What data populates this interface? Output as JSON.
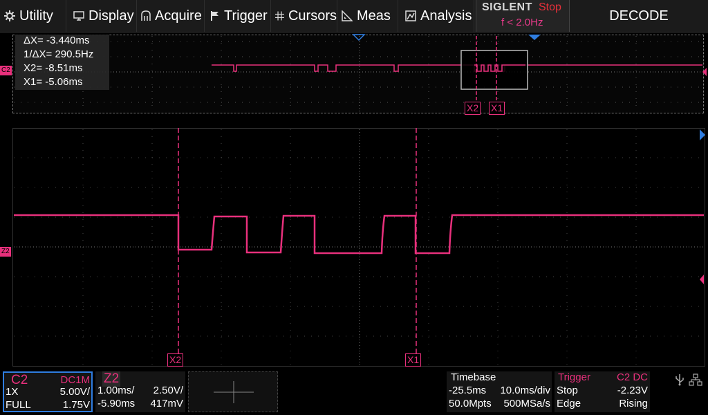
{
  "menu": {
    "items": [
      {
        "label": "Utility",
        "icon": "gear-icon"
      },
      {
        "label": "Display",
        "icon": "monitor-icon"
      },
      {
        "label": "Acquire",
        "icon": "acquire-icon"
      },
      {
        "label": "Trigger",
        "icon": "flag-icon"
      },
      {
        "label": "Cursors",
        "icon": "cursor-grid-icon"
      },
      {
        "label": "Meas",
        "icon": "measure-icon"
      },
      {
        "label": "Analysis",
        "icon": "analysis-icon"
      }
    ],
    "brand": "SIGLENT",
    "run_state": "Stop",
    "trigger_freq": "f < 2.0Hz",
    "decode": "DECODE"
  },
  "cursor_readout": {
    "delta_x": "ΔX= -3.440ms",
    "inv_delta_x": "1/ΔX= 290.5Hz",
    "x2": "X2= -8.51ms",
    "x1": "X1= -5.06ms"
  },
  "markers": {
    "x1": "X1",
    "x2": "X2",
    "channel_overview": "C2",
    "channel_zoom": "Z2"
  },
  "channel_panel": {
    "name": "C2",
    "coupling": "DC1M",
    "probe": "1X",
    "scale": "5.00V/",
    "bandwidth": "FULL",
    "offset": "1.75V"
  },
  "zoom_panel": {
    "name": "Z2",
    "timebase": "1.00ms/",
    "scale": "2.50V/",
    "delay": "-5.90ms",
    "offset": "417mV"
  },
  "timebase_panel": {
    "title": "Timebase",
    "delay": "-25.5ms",
    "scale": "10.0ms/div",
    "memory": "50.0Mpts",
    "sample_rate": "500MSa/s"
  },
  "trigger_panel": {
    "title": "Trigger",
    "source": "C2 DC",
    "state": "Stop",
    "level": "-2.23V",
    "type": "Edge",
    "slope": "Rising"
  },
  "colors": {
    "channel": "#e8307c",
    "accent": "#2f7de0",
    "background": "#000000"
  }
}
